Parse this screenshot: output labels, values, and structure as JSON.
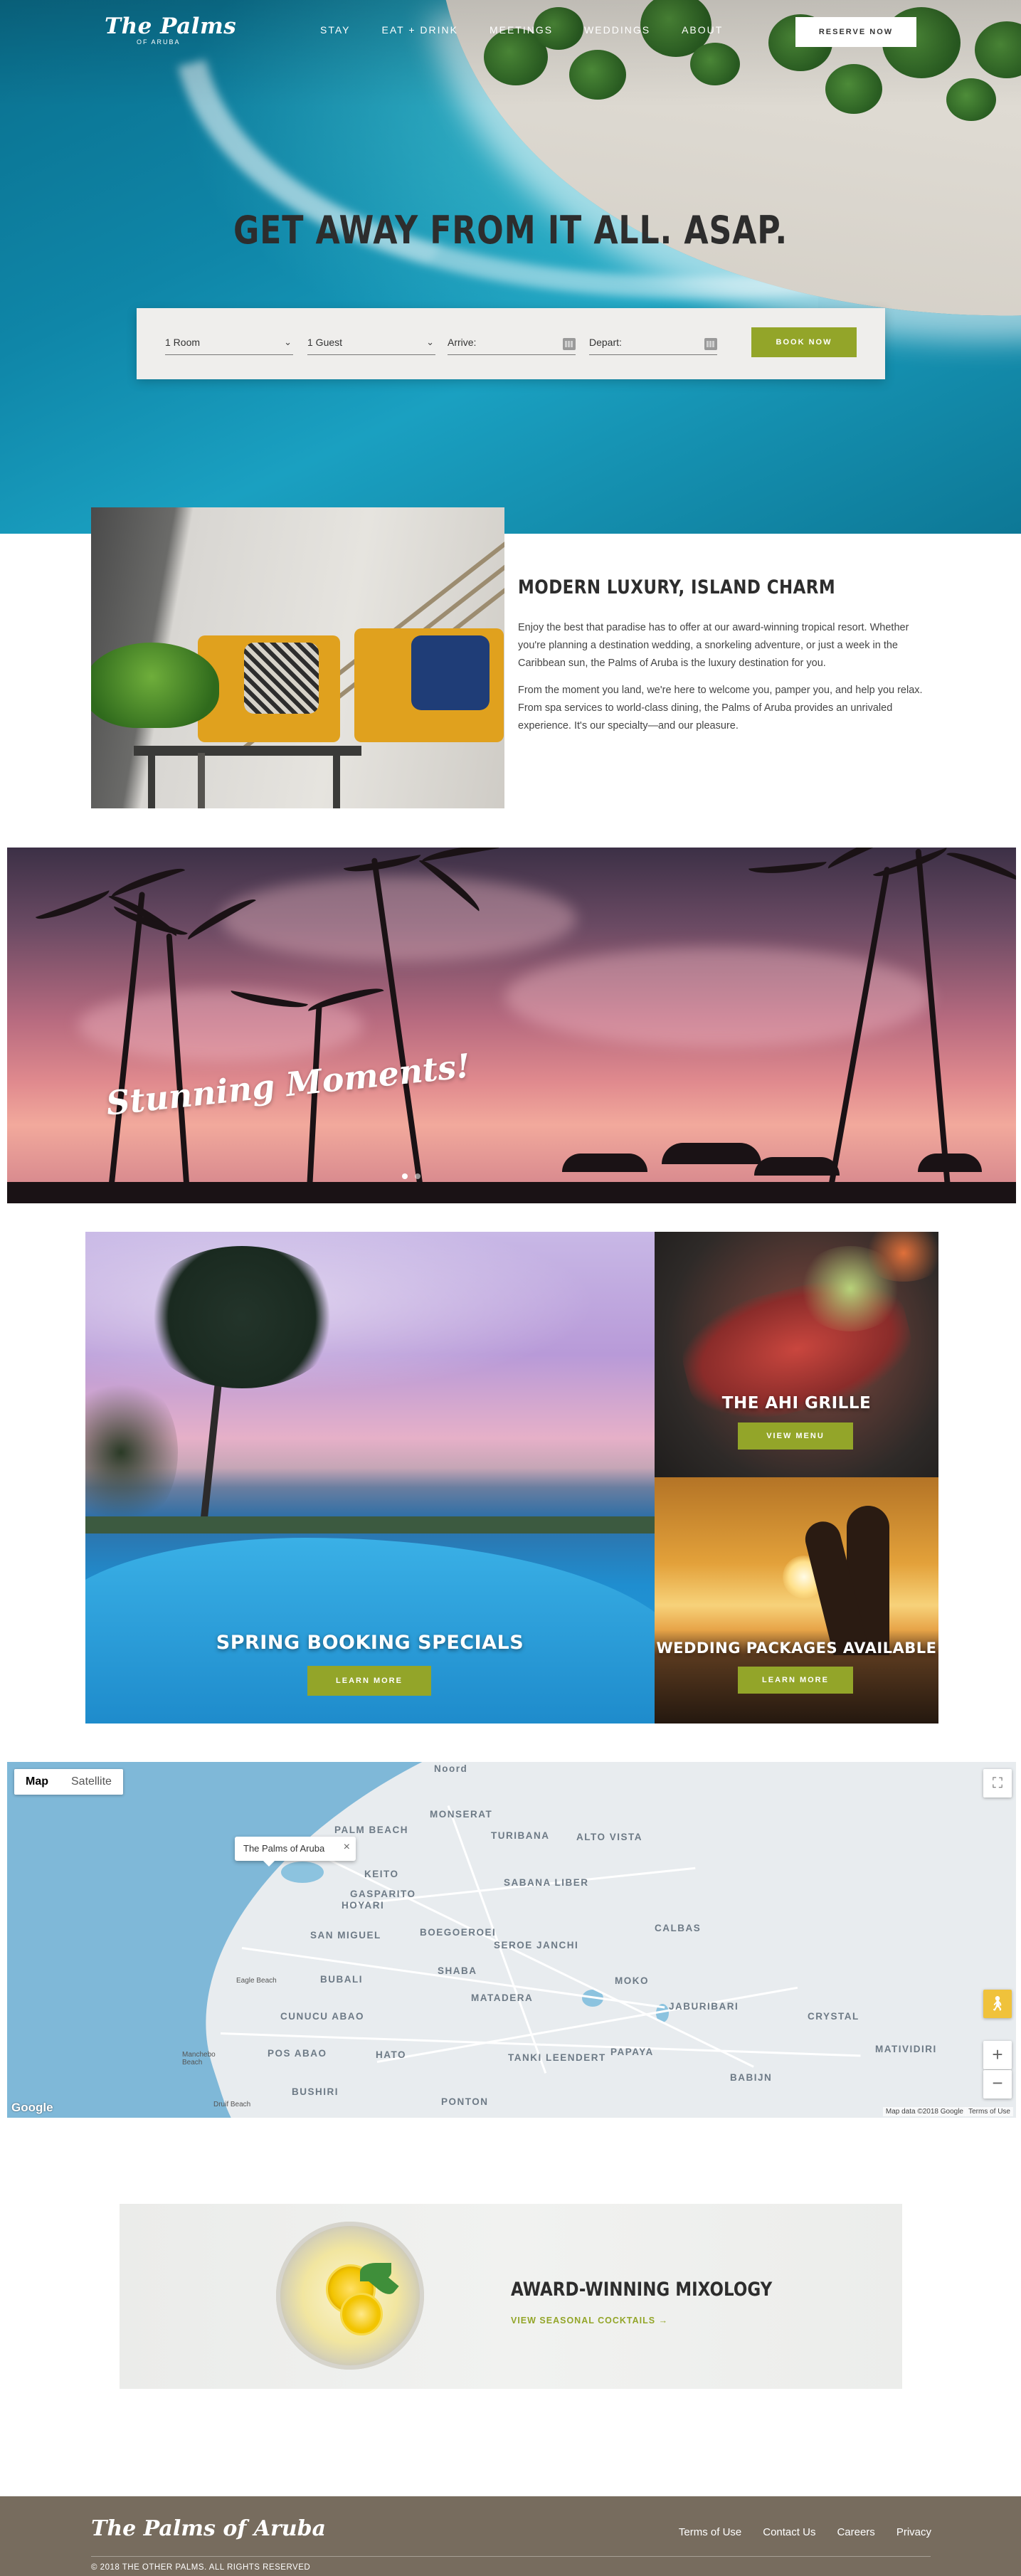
{
  "brand": {
    "name": "The Palms",
    "sub": "OF ARUBA",
    "footer_name": "The Palms of Aruba"
  },
  "nav": {
    "items": [
      "STAY",
      "EAT + DRINK",
      "MEETINGS",
      "WEDDINGS",
      "ABOUT"
    ],
    "reserve": "RESERVE NOW"
  },
  "hero": {
    "headline": "GET AWAY FROM IT ALL. ASAP."
  },
  "booking": {
    "rooms": "1 Room",
    "guests": "1 Guest",
    "arrive_label": "Arrive:",
    "depart_label": "Depart:",
    "submit": "BOOK NOW"
  },
  "intro": {
    "title": "MODERN LUXURY, ISLAND CHARM",
    "p1": "Enjoy the best that paradise has to offer at our award-winning tropical resort. Whether you're planning a destination wedding, a snorkeling adventure, or just a week in the Caribbean sun, the Palms of Aruba is the luxury destination for you.",
    "p2": "From the moment you land, we're here to welcome you, pamper you, and help you relax. From spa services to world-class dining, the Palms of Aruba provides an unrivaled experience. It's our specialty—and our pleasure."
  },
  "banner": {
    "script": "Stunning Moments!"
  },
  "tiles": {
    "pool": {
      "title": "SPRING BOOKING SPECIALS",
      "button": "LEARN MORE"
    },
    "ahi": {
      "title": "THE AHI GRILLE",
      "button": "VIEW MENU"
    },
    "wedding": {
      "title": "WEDDING PACKAGES AVAILABLE",
      "button": "LEARN MORE"
    }
  },
  "map": {
    "tab_map": "Map",
    "tab_satellite": "Satellite",
    "marker": "The Palms of Aruba",
    "labels": [
      "Noord",
      "MONSERAT",
      "PALM BEACH",
      "TURIBANA",
      "ALTO VISTA",
      "KEITO",
      "SABANA LIBER",
      "GASPARITO",
      "HOYARI",
      "SAN MIGUEL",
      "BOEGOEROEI",
      "SEROE JANCHI",
      "CALBAS",
      "BUBALI",
      "SHABA",
      "MATADERA",
      "MOKO",
      "JABURIBARI",
      "CRYSTAL",
      "CUNUCU ABAO",
      "POS ABAO",
      "HATO",
      "TANKI LEENDERT",
      "PAPAYA",
      "MATIVIDIRI",
      "BABIJN",
      "BUSHIRI",
      "PONTON"
    ],
    "small_labels": [
      "Eagle Beach",
      "Manchebo Beach",
      "Druif Beach"
    ],
    "google": "Google",
    "data": "Map data ©2018 Google",
    "terms": "Terms of Use"
  },
  "mixology": {
    "title": "AWARD-WINNING MIXOLOGY",
    "link": "VIEW SEASONAL COCKTAILS →"
  },
  "footer": {
    "links": [
      "Terms of Use",
      "Contact Us",
      "Careers",
      "Privacy"
    ],
    "copyright": "© 2018 THE OTHER PALMS. ALL RIGHTS RESERVED"
  }
}
